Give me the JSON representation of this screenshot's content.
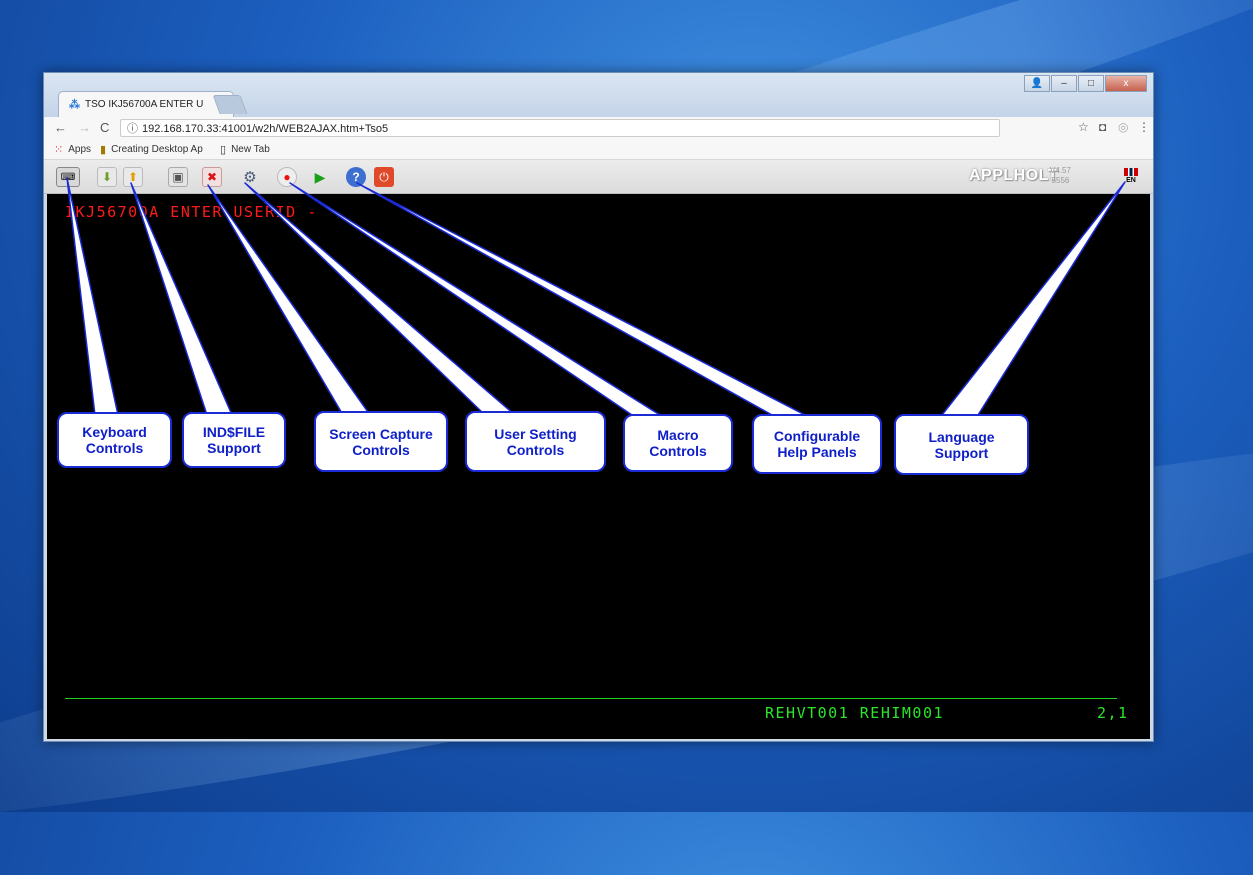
{
  "tab": {
    "title": "TSO IKJ56700A ENTER U",
    "close": "×"
  },
  "window_controls": {
    "minimize": "–",
    "maximize": "□",
    "close": "x"
  },
  "address": {
    "url": "192.168.170.33:41001/w2h/WEB2AJAX.htm+Tso5"
  },
  "bookmarks": [
    {
      "label": "Apps"
    },
    {
      "label": "Creating Desktop Ap"
    },
    {
      "label": "New Tab"
    }
  ],
  "toolbar": {
    "brand": "APPLHOLT",
    "version": "V4.57",
    "build": "5556",
    "language": "EN"
  },
  "terminal": {
    "prompt": "IKJ56700A ENTER USERID -",
    "status_left": "REHVT001 REHIM001",
    "cursor_pos": "2,1"
  },
  "callouts": [
    {
      "id": "keyboard",
      "text": "Keyboard Controls"
    },
    {
      "id": "indfile",
      "text": "IND$FILE Support"
    },
    {
      "id": "capture",
      "text": "Screen Capture Controls"
    },
    {
      "id": "settings",
      "text": "User Setting Controls"
    },
    {
      "id": "macro",
      "text": "Macro Controls"
    },
    {
      "id": "help",
      "text": "Configurable Help Panels"
    },
    {
      "id": "language",
      "text": "Language Support"
    }
  ],
  "colors": {
    "terminal_bg": "#000000",
    "prompt": "#ff1a1a",
    "status": "#29e629",
    "callout_border": "#1a2bd6",
    "callout_text": "#1020c8"
  }
}
